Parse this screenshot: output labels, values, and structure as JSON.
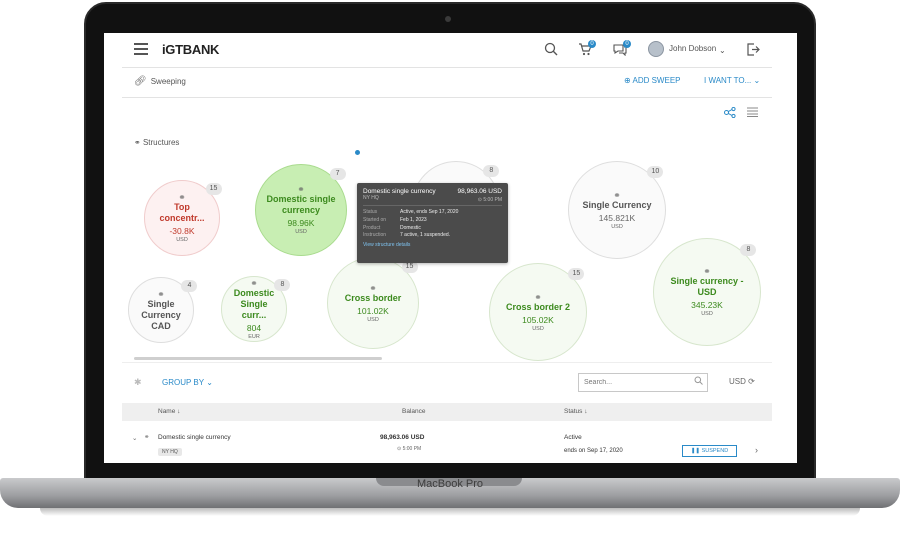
{
  "device": {
    "model": "MacBook Pro"
  },
  "header": {
    "logo": "iGTBANK",
    "cart_badge": "0",
    "messages_badge": "0",
    "user_name": "John Dobson"
  },
  "subheader": {
    "breadcrumb": "Sweeping",
    "add_sweep": "ADD SWEEP",
    "want_to": "I WANT TO..."
  },
  "structures": {
    "title": "Structures",
    "bubbles": [
      {
        "name": "Top concentr...",
        "value": "-30.8K",
        "currency": "USD",
        "count": "15",
        "style": "red"
      },
      {
        "name": "Domestic single currency",
        "value": "98.96K",
        "currency": "USD",
        "count": "7",
        "style": "green-selected"
      },
      {
        "name": "",
        "value": "",
        "currency": "",
        "count": "8",
        "style": "grey"
      },
      {
        "name": "Single Currency",
        "value": "145.821K",
        "currency": "USD",
        "count": "10",
        "style": "grey"
      },
      {
        "name": "Single Currency CAD",
        "value": "",
        "currency": "",
        "count": "4",
        "style": "grey"
      },
      {
        "name": "Domestic Single curr...",
        "value": "804",
        "currency": "EUR",
        "count": "8",
        "style": "green"
      },
      {
        "name": "Cross border",
        "value": "101.02K",
        "currency": "USD",
        "count": "15",
        "style": "green"
      },
      {
        "name": "Cross border 2",
        "value": "105.02K",
        "currency": "USD",
        "count": "15",
        "style": "green"
      },
      {
        "name": "Single currency - USD",
        "value": "345.23K",
        "currency": "USD",
        "count": "8",
        "style": "green"
      }
    ]
  },
  "tooltip": {
    "title": "Domestic single currency",
    "amount": "98,963.06 USD",
    "sub": "NY HQ",
    "time": "5:00 PM",
    "rows": [
      {
        "k": "Status",
        "v": "Active, ends Sep 17, 2020"
      },
      {
        "k": "Started on",
        "v": "Feb 1, 2023"
      },
      {
        "k": "Product",
        "v": "Domestic"
      },
      {
        "k": "Instruction",
        "v": "7 active, 1 suspended."
      }
    ],
    "link": "View structure details"
  },
  "toolbar": {
    "group_by": "GROUP BY",
    "search_placeholder": "Search...",
    "currency": "USD"
  },
  "table": {
    "columns": [
      "Name",
      "Balance",
      "Status"
    ],
    "rows": [
      {
        "name": "Domestic single currency",
        "tag": "NY HQ",
        "balance": "98,963.06 USD",
        "time": "5:00 PM",
        "status": "Active",
        "status_sub": "ends on Sep 17, 2020",
        "action": "SUSPEND"
      }
    ]
  },
  "colors": {
    "accent": "#2a8ac8",
    "positive": "#3c8a1e",
    "negative": "#c0392b"
  }
}
